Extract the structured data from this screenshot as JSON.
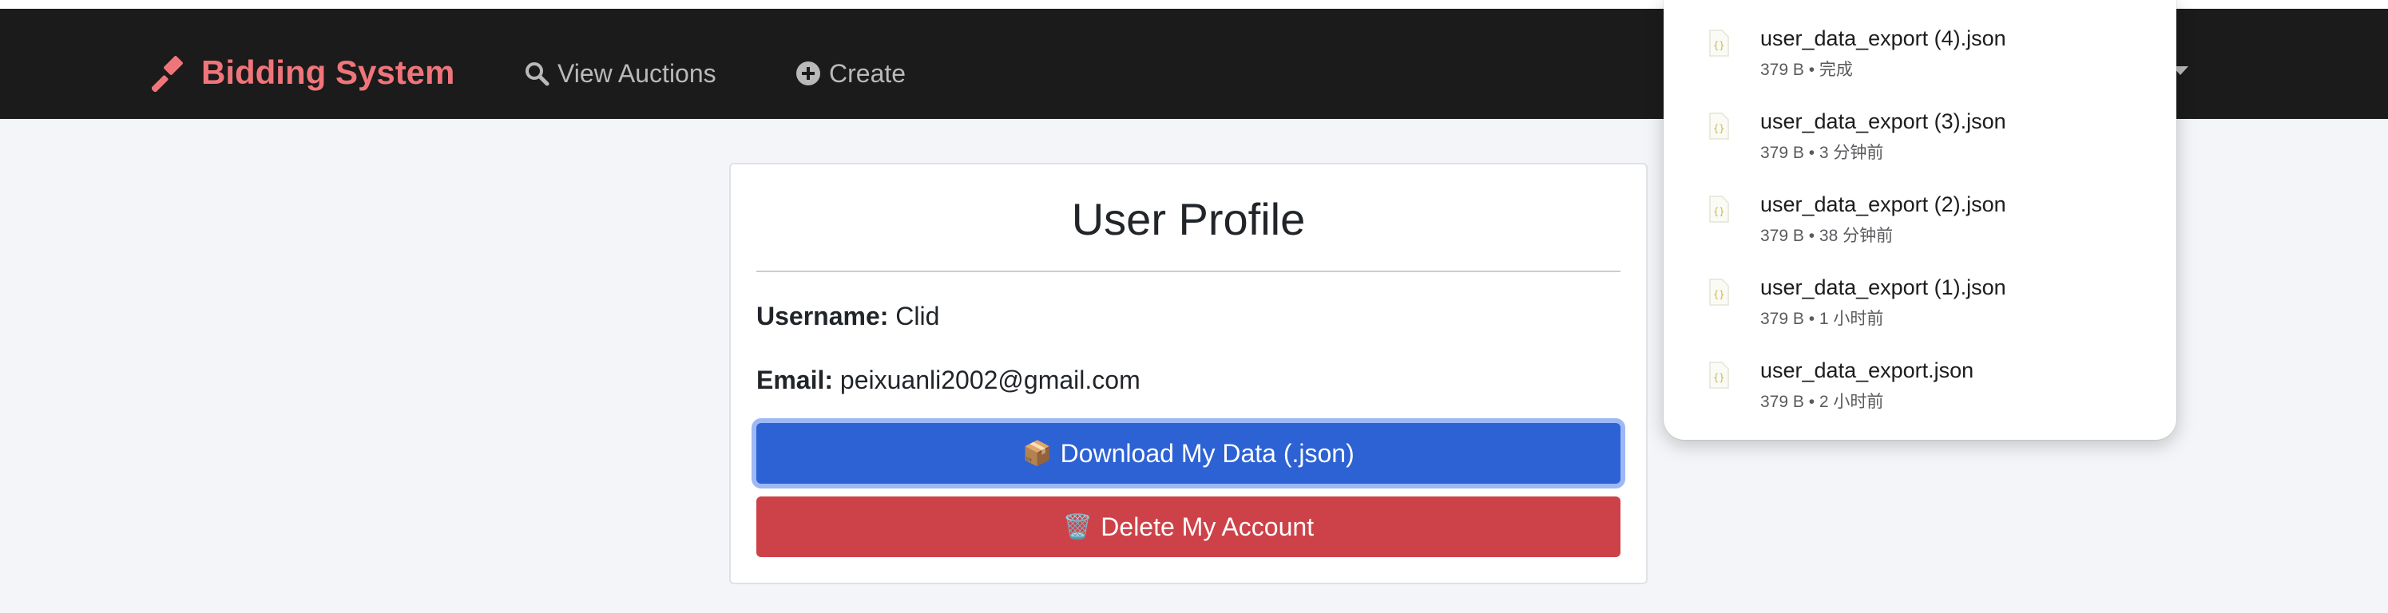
{
  "navbar": {
    "brand": "Bidding System",
    "links": [
      {
        "label": "View Auctions"
      },
      {
        "label": "Create"
      }
    ]
  },
  "profile": {
    "title": "User Profile",
    "username_label": "Username:",
    "username_value": "Clid",
    "email_label": "Email:",
    "email_value": "peixuanli2002@gmail.com",
    "download_icon": "📦",
    "download_label": "Download My Data (.json)",
    "delete_icon": "🗑️",
    "delete_label": "Delete My Account"
  },
  "downloads": {
    "items": [
      {
        "name": "user_data_export (4).json",
        "meta": "379 B • 完成"
      },
      {
        "name": "user_data_export (3).json",
        "meta": "379 B • 3 分钟前"
      },
      {
        "name": "user_data_export (2).json",
        "meta": "379 B • 38 分钟前"
      },
      {
        "name": "user_data_export (1).json",
        "meta": "379 B • 1 小时前"
      },
      {
        "name": "user_data_export.json",
        "meta": "379 B • 2 小时前"
      }
    ]
  },
  "colors": {
    "navbar": "#1b1b1b",
    "brand": "#f0757a",
    "primary": "#2c62d4",
    "danger": "#cd4248"
  }
}
